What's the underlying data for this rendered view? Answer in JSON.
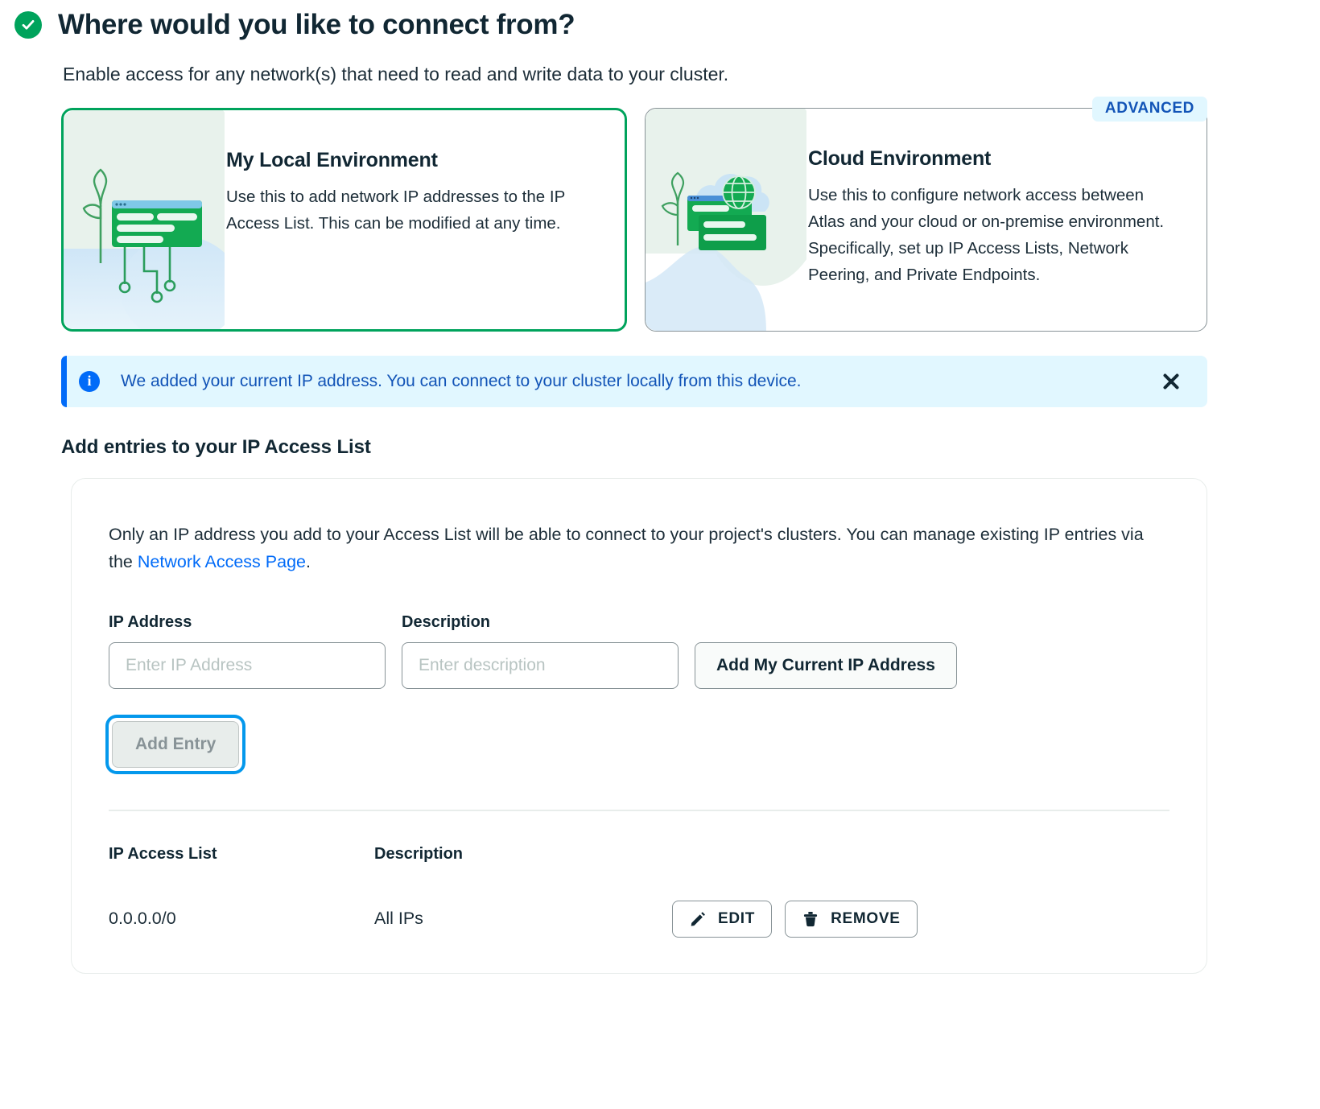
{
  "header": {
    "title": "Where would you like to connect from?",
    "status_icon": "check-circle-icon",
    "accent_green": "#00A35C",
    "subtitle": "Enable access for any network(s) that need to read and write data to your cluster."
  },
  "environment_cards": [
    {
      "title": "My Local Environment",
      "description": "Use this to add network IP addresses to the IP Access List. This can be modified at any time.",
      "selected": true,
      "badge": null,
      "illustration": "local-environment-illustration"
    },
    {
      "title": "Cloud Environment",
      "description": "Use this to configure network access between Atlas and your cloud or on-premise environment. Specifically, set up IP Access Lists, Network Peering, and Private Endpoints.",
      "selected": false,
      "badge": "ADVANCED",
      "illustration": "cloud-environment-illustration"
    }
  ],
  "banner": {
    "icon": "info-icon",
    "text": "We added your current IP address. You can connect to your cluster locally from this device.",
    "close_icon": "close-icon",
    "accent_blue": "#016BF8",
    "background": "#E1F7FF"
  },
  "section": {
    "heading": "Add entries to your IP Access List",
    "intro_part1": "Only an IP address you add to your Access List will be able to connect to your project's clusters. You can manage existing IP entries via the ",
    "intro_link": "Network Access Page",
    "intro_part2": "."
  },
  "form": {
    "ip_label": "IP Address",
    "ip_placeholder": "Enter IP Address",
    "ip_value": "",
    "desc_label": "Description",
    "desc_placeholder": "Enter description",
    "desc_value": "",
    "current_ip_button": "Add My Current IP Address",
    "add_entry_button": "Add Entry",
    "add_entry_disabled": true,
    "add_entry_focused": true,
    "focus_ring_color": "#0498EC"
  },
  "table": {
    "columns": [
      "IP Access List",
      "Description"
    ],
    "rows": [
      {
        "ip": "0.0.0.0/0",
        "description": "All IPs",
        "actions": [
          {
            "label": "EDIT",
            "icon": "pencil-icon"
          },
          {
            "label": "REMOVE",
            "icon": "trash-icon"
          }
        ]
      }
    ]
  }
}
